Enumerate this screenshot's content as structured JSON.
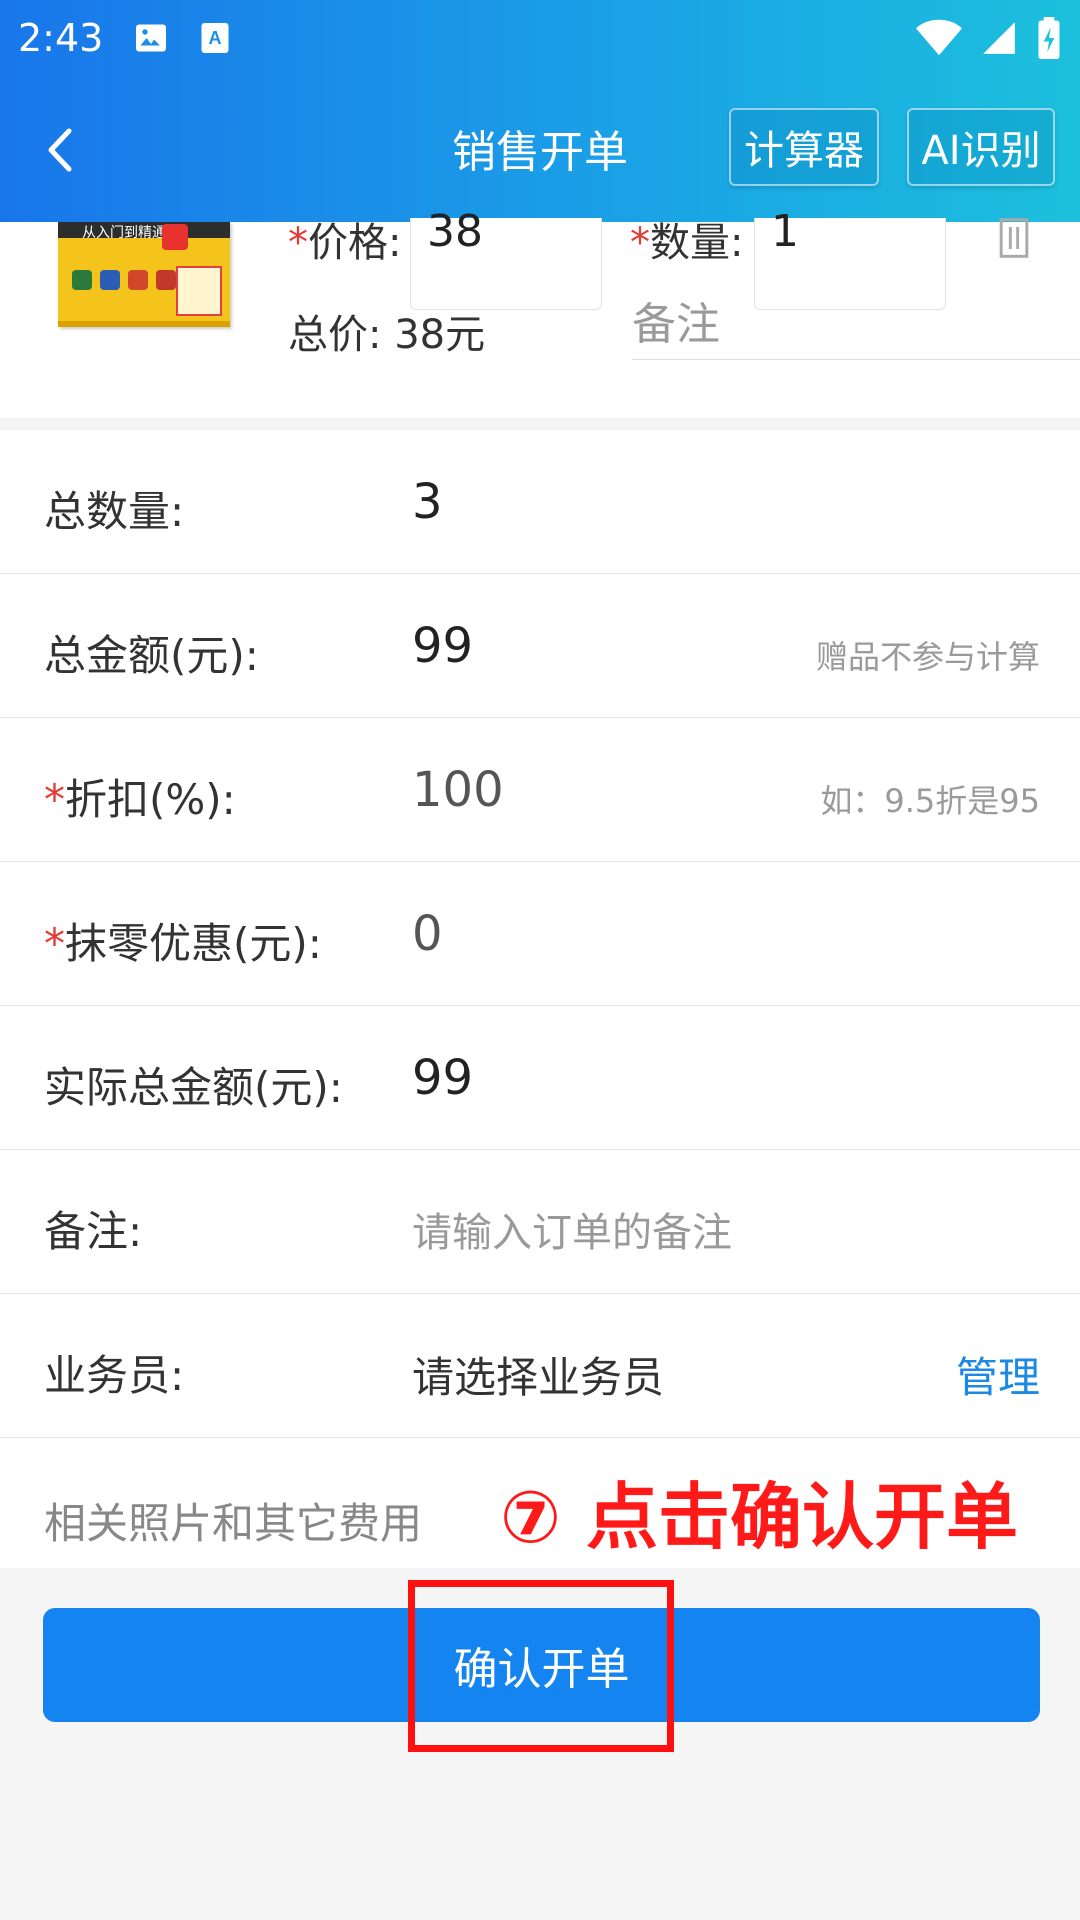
{
  "status_bar": {
    "time": "2:43",
    "icons_left": [
      "image-icon",
      "text-a-icon"
    ],
    "icons_right": [
      "wifi-icon",
      "signal-icon",
      "battery-icon"
    ]
  },
  "nav": {
    "back_icon": "chevron-left-icon",
    "title": "销售开单",
    "calculator_label": "计算器",
    "ai_label": "AI识别"
  },
  "item": {
    "price_label": "价格:",
    "price_value": "38",
    "quantity_label": "数量:",
    "quantity_value": "1",
    "total_label": "总价: 38元",
    "remark_placeholder": "备注",
    "book_title": "从入门到精通"
  },
  "summary": {
    "total_qty_label": "总数量:",
    "total_qty_value": "3",
    "total_amount_label": "总金额(元):",
    "total_amount_value": "99",
    "total_amount_hint": "赠品不参与计算",
    "discount_label": "折扣(%):",
    "discount_value": "100",
    "discount_hint": "如：9.5折是95",
    "rounding_label": "抹零优惠(元):",
    "rounding_value": "0",
    "actual_total_label": "实际总金额(元):",
    "actual_total_value": "99",
    "remark_label": "备注:",
    "remark_placeholder": "请输入订单的备注",
    "salesperson_label": "业务员:",
    "salesperson_placeholder": "请选择业务员",
    "manage_label": "管理",
    "photos_label": "相关照片和其它费用"
  },
  "annotation_text": "⑦ 点击确认开单",
  "confirm_label": "确认开单",
  "colors": {
    "primary": "#1485f0",
    "required": "#e53935",
    "annotation": "#ff1010"
  }
}
